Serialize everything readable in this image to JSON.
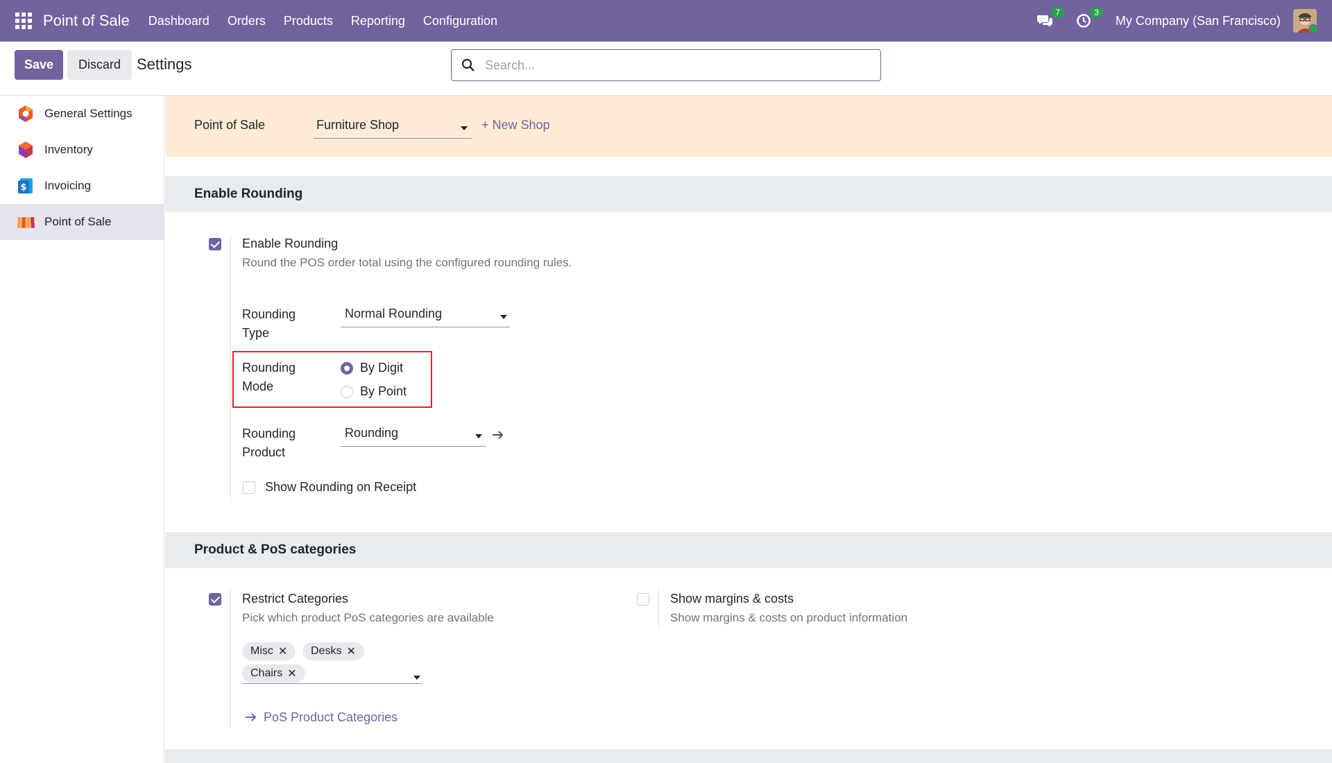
{
  "navbar": {
    "app_name": "Point of Sale",
    "menu": [
      "Dashboard",
      "Orders",
      "Products",
      "Reporting",
      "Configuration"
    ],
    "messages_count": "7",
    "activities_count": "3",
    "company": "My Company (San Francisco)"
  },
  "control_panel": {
    "save_label": "Save",
    "discard_label": "Discard",
    "title": "Settings",
    "search_placeholder": "Search..."
  },
  "sidebar": {
    "items": [
      {
        "label": "General Settings",
        "icon": "general-settings-icon"
      },
      {
        "label": "Inventory",
        "icon": "inventory-icon"
      },
      {
        "label": "Invoicing",
        "icon": "invoicing-icon"
      },
      {
        "label": "Point of Sale",
        "icon": "point-of-sale-icon",
        "active": true
      }
    ]
  },
  "pos_bar": {
    "label": "Point of Sale",
    "shop": "Furniture Shop",
    "new_shop": "+ New Shop"
  },
  "rounding_section": {
    "header": "Enable Rounding",
    "enable_title": "Enable Rounding",
    "enable_desc": "Round the POS order total using the configured rounding rules.",
    "enabled": true,
    "type_label": "Rounding Type",
    "type_value": "Normal Rounding",
    "mode_label": "Rounding Mode",
    "mode_options": [
      "By Digit",
      "By Point"
    ],
    "mode_selected": "By Digit",
    "product_label": "Rounding Product",
    "product_value": "Rounding",
    "show_on_receipt_label": "Show Rounding on Receipt",
    "show_on_receipt": false
  },
  "categories_section": {
    "header": "Product & PoS categories",
    "restrict_title": "Restrict Categories",
    "restrict_desc": "Pick which product PoS categories are available",
    "restrict_enabled": true,
    "tags": [
      "Misc",
      "Desks",
      "Chairs"
    ],
    "pos_categories_link": "PoS Product Categories",
    "margins_title": "Show margins & costs",
    "margins_desc": "Show margins & costs on product information",
    "margins_enabled": false
  },
  "colors": {
    "brand": "#71639e",
    "highlight": "#e8202a",
    "pos_bar": "#feecd5"
  }
}
